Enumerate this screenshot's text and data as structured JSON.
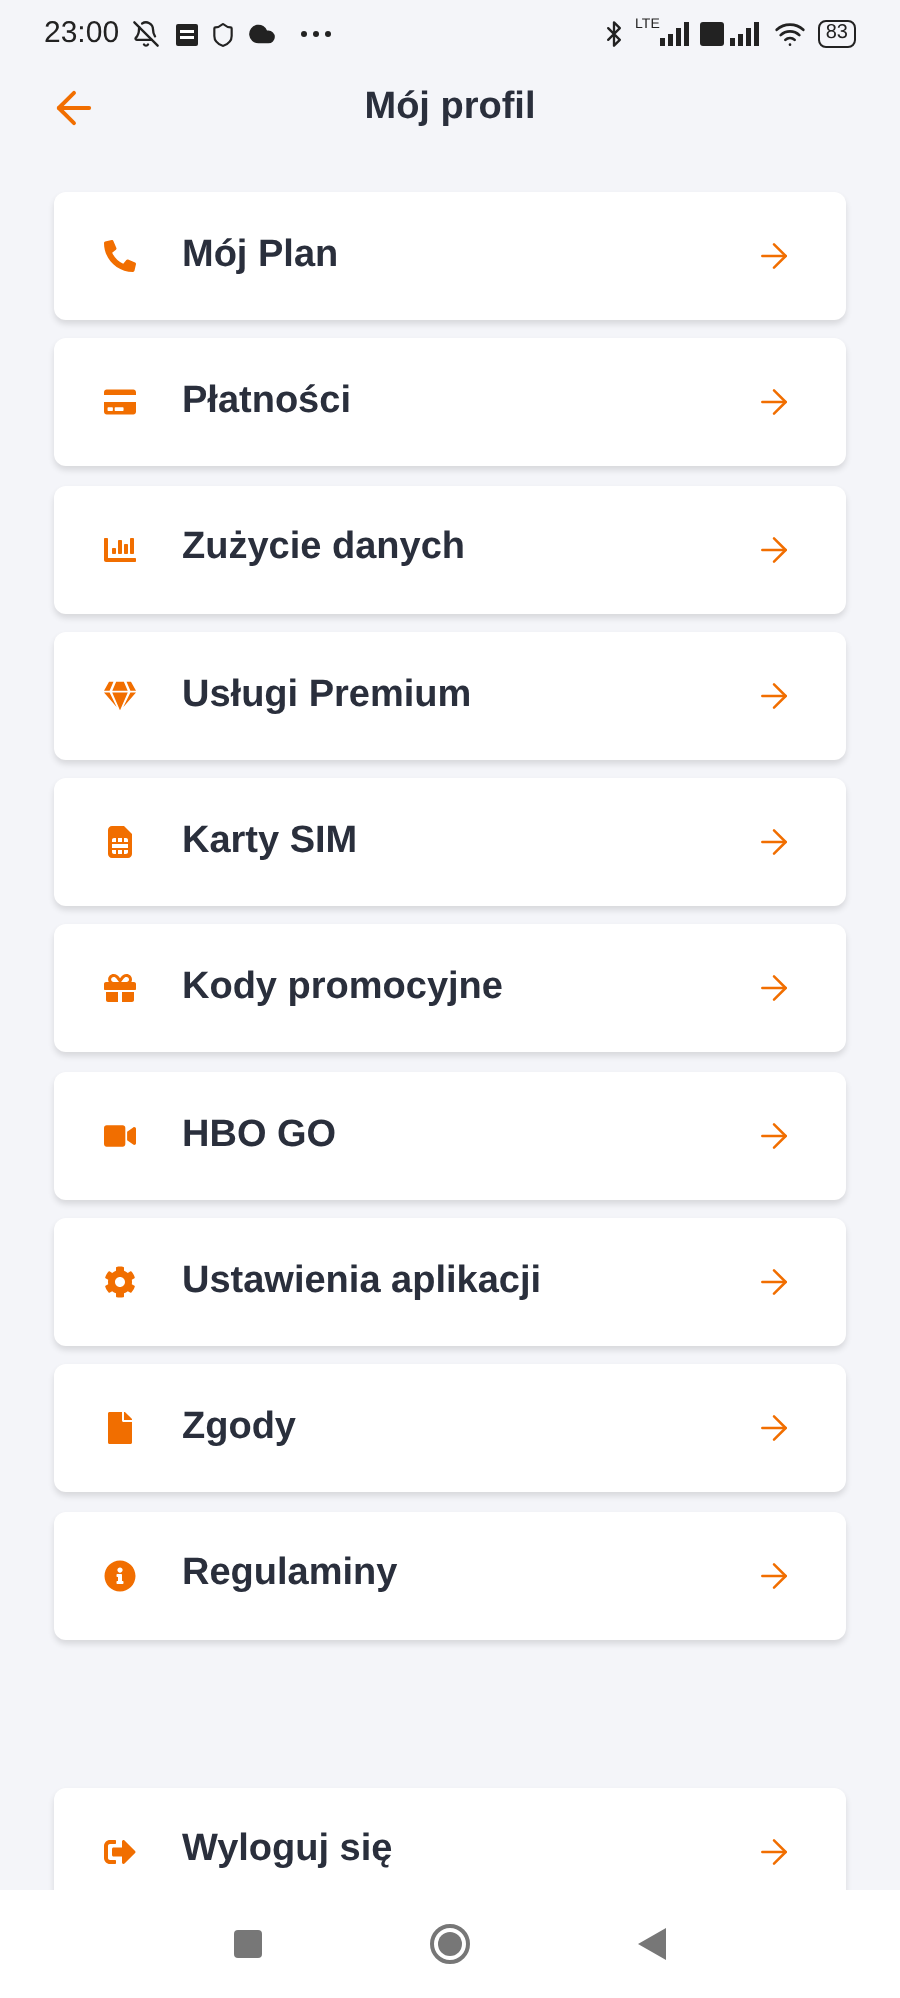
{
  "status_bar": {
    "time": "23:00",
    "network_label": "LTE",
    "battery": "83"
  },
  "header": {
    "title": "Mój profil"
  },
  "menu": [
    {
      "kind": "phone",
      "label": "Mój Plan"
    },
    {
      "kind": "card",
      "label": "Płatności"
    },
    {
      "kind": "chart",
      "label": "Zużycie danych"
    },
    {
      "kind": "gem",
      "label": "Usługi Premium"
    },
    {
      "kind": "sim",
      "label": "Karty SIM"
    },
    {
      "kind": "gift",
      "label": "Kody promocyjne"
    },
    {
      "kind": "video",
      "label": "HBO GO"
    },
    {
      "kind": "gear",
      "label": "Ustawienia aplikacji"
    },
    {
      "kind": "file",
      "label": "Zgody"
    },
    {
      "kind": "info",
      "label": "Regulaminy"
    }
  ],
  "logout": {
    "kind": "logout",
    "label": "Wyloguj się"
  }
}
